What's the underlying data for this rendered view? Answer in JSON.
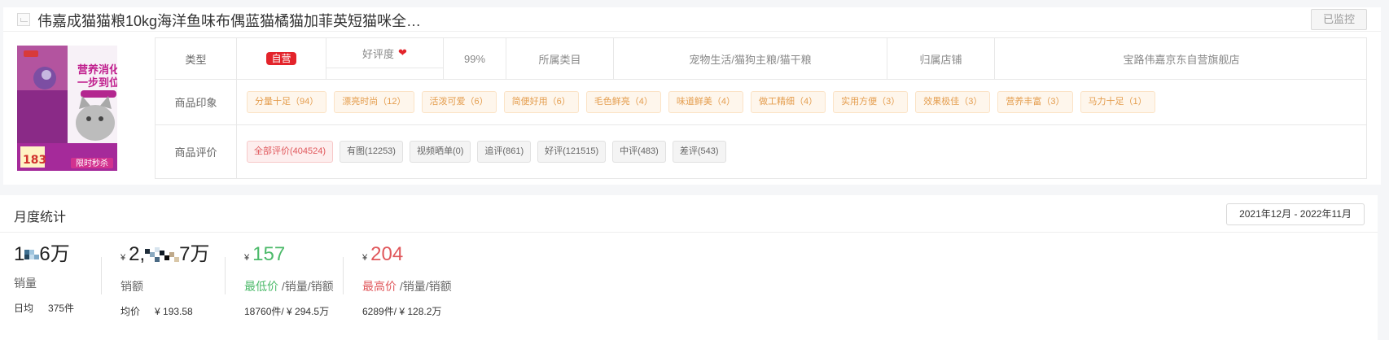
{
  "product": {
    "title": "伟嘉成猫猫粮10kg海洋鱼味布偶蓝猫橘猫加菲英短猫咪全…",
    "monitor_button": "已监控"
  },
  "info": {
    "type_label": "类型",
    "type_badge": "自营",
    "rating_label": "好评度",
    "rating_value": "99%",
    "category_label": "所属类目",
    "category_value": "宠物生活/猫狗主粮/猫干粮",
    "store_label": "归属店铺",
    "store_value": "宝路伟嘉京东自营旗舰店",
    "impression_label": "商品印象",
    "impressions": [
      "分量十足（94）",
      "漂亮时尚（12）",
      "活泼可爱（6）",
      "简便好用（6）",
      "毛色鲜亮（4）",
      "味道鲜美（4）",
      "做工精细（4）",
      "实用方便（3）",
      "效果极佳（3）",
      "营养丰富（3）",
      "马力十足（1）"
    ],
    "review_label": "商品评价",
    "reviews": [
      "全部评价(404524)",
      "有图(12253)",
      "视频晒单(0)",
      "追评(861)",
      "好评(121515)",
      "中评(483)",
      "差评(543)"
    ]
  },
  "monthly": {
    "title": "月度统计",
    "date_range": "2021年12月 - 2022年11月",
    "sales": {
      "value_a": "1",
      "value_b": "6万",
      "label": "销量",
      "daily_label": "日均",
      "daily_value": "375件"
    },
    "revenue": {
      "currency": "¥",
      "value_a": "2,",
      "value_b": "7万",
      "label": "销额",
      "avg_label": "均价",
      "avg_value": "¥ 193.58"
    },
    "lowest": {
      "currency": "¥",
      "value": "157",
      "label": "最低价",
      "suffix": " /销量/销额",
      "detail": "18760件/ ¥ 294.5万"
    },
    "highest": {
      "currency": "¥",
      "value": "204",
      "label": "最高价",
      "suffix": " /销量/销额",
      "detail": "6289件/ ¥ 128.2万"
    }
  },
  "colors": {
    "accent_red": "#e3242b",
    "green": "#4cba6a",
    "red": "#e0575b",
    "tag_orange": "#e49d4e"
  }
}
